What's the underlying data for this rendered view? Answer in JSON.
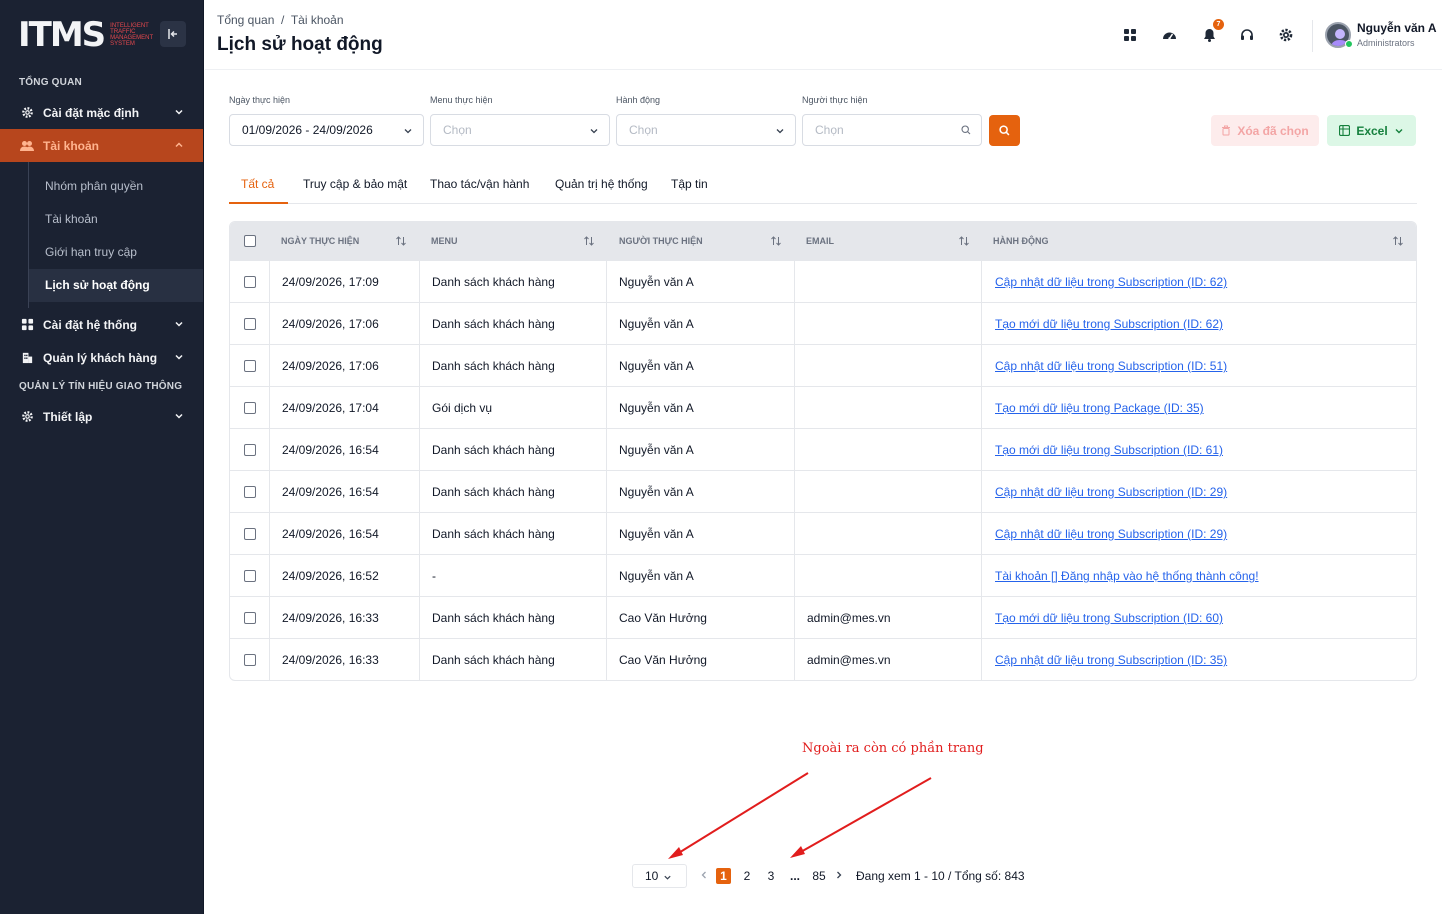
{
  "brand": {
    "logo": "ITMS",
    "sub": "Intelligent Traffic Management System"
  },
  "sidebar": {
    "section1": "TỔNG QUAN",
    "item_default_settings": "Cài đặt mặc định",
    "item_accounts": "Tài khoản",
    "sub_items": [
      "Nhóm phân quyền",
      "Tài khoản",
      "Giới hạn truy cập",
      "Lịch sử hoạt động"
    ],
    "item_system_settings": "Cài đặt hệ thống",
    "item_customers": "Quản lý khách hàng",
    "section2": "QUẢN LÝ TÍN HIỆU GIAO THÔNG",
    "item_setup": "Thiết lập"
  },
  "header": {
    "breadcrumb": "Tổng quan  /  Tài khoản",
    "title": "Lịch sử hoạt động",
    "notification_count": "7",
    "user_name": "Nguyễn văn A",
    "user_role": "Administrators"
  },
  "filters": {
    "date_label": "Ngày thực hiện",
    "date_value": "01/09/2026 - 24/09/2026",
    "menu_label": "Menu thực hiện",
    "menu_placeholder": "Chọn",
    "action_label": "Hành động",
    "action_placeholder": "Chọn",
    "user_label": "Người thực hiện",
    "user_placeholder": "Chọn",
    "delete_label": "Xóa đã chọn",
    "excel_label": "Excel"
  },
  "tabs": [
    "Tất cả",
    "Truy cập & bảo mật",
    "Thao tác/vận hành",
    "Quản trị hệ thống",
    "Tập tin"
  ],
  "table": {
    "headers": [
      "NGÀY THỰC HIỆN",
      "MENU",
      "NGƯỜI THỰC HIỆN",
      "EMAIL",
      "HÀNH ĐỘNG"
    ],
    "rows": [
      [
        "24/09/2026, 17:09",
        "Danh sách khách hàng",
        "Nguyễn văn A",
        "",
        "Cập nhật dữ liệu trong Subscription (ID: 62)"
      ],
      [
        "24/09/2026, 17:06",
        "Danh sách khách hàng",
        "Nguyễn văn A",
        "",
        "Tạo mới dữ liệu trong Subscription (ID: 62)"
      ],
      [
        "24/09/2026, 17:06",
        "Danh sách khách hàng",
        "Nguyễn văn A",
        "",
        "Cập nhật dữ liệu trong Subscription (ID: 51)"
      ],
      [
        "24/09/2026, 17:04",
        "Gói dịch vụ",
        "Nguyễn văn A",
        "",
        "Tạo mới dữ liệu trong Package (ID: 35)"
      ],
      [
        "24/09/2026, 16:54",
        "Danh sách khách hàng",
        "Nguyễn văn A",
        "",
        "Tạo mới dữ liệu trong Subscription (ID: 61)"
      ],
      [
        "24/09/2026, 16:54",
        "Danh sách khách hàng",
        "Nguyễn văn A",
        "",
        "Cập nhật dữ liệu trong Subscription (ID: 29)"
      ],
      [
        "24/09/2026, 16:54",
        "Danh sách khách hàng",
        "Nguyễn văn A",
        "",
        "Cập nhật dữ liệu trong Subscription (ID: 29)"
      ],
      [
        "24/09/2026, 16:52",
        "-",
        "Nguyễn văn A",
        "",
        "Tài khoản [] Đăng nhập vào hệ thống thành công!"
      ],
      [
        "24/09/2026, 16:33",
        "Danh sách khách hàng",
        "Cao Văn Hưởng",
        "admin@mes.vn",
        "Tạo mới dữ liệu trong Subscription (ID: 60)"
      ],
      [
        "24/09/2026, 16:33",
        "Danh sách khách hàng",
        "Cao Văn Hưởng",
        "admin@mes.vn",
        "Cập nhật dữ liệu trong Subscription (ID: 35)"
      ]
    ]
  },
  "annotation": "Ngoài ra còn có phần trang",
  "pagination": {
    "page_size": "10",
    "pages": [
      "1",
      "2",
      "3",
      "...",
      "85"
    ],
    "info": "Đang xem 1 - 10 / Tổng số: 843"
  },
  "colors": {
    "accent": "#e5620e",
    "sidebar_bg": "#1b2232",
    "link": "#2563eb",
    "annotation": "#e11d1d"
  }
}
